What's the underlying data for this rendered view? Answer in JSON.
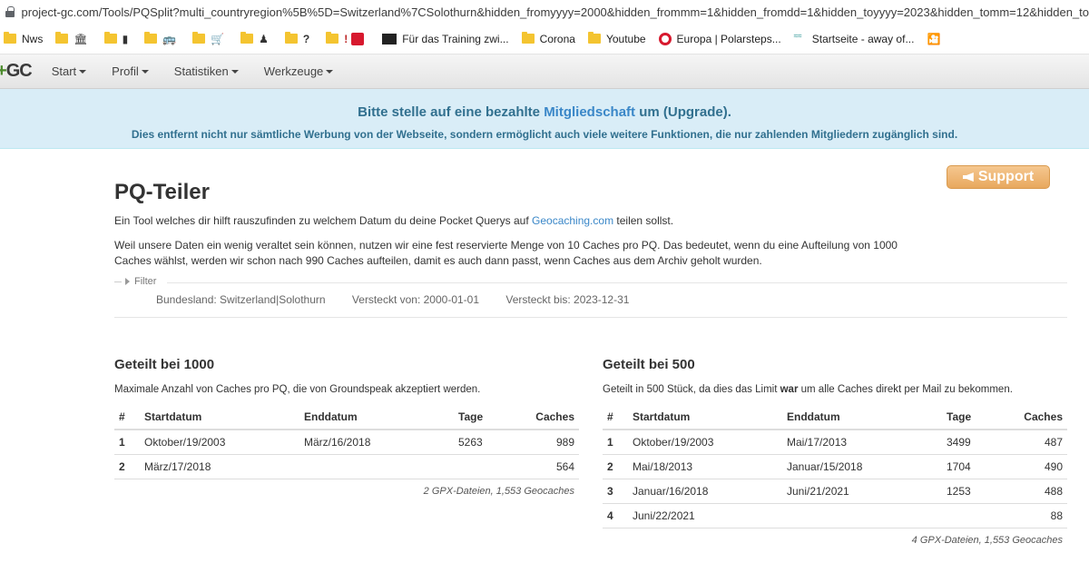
{
  "browser": {
    "url": "project-gc.com/Tools/PQSplit?multi_countryregion%5B%5D=Switzerland%7CSolothurn&hidden_fromyyyy=2000&hidden_frommm=1&hidden_fromdd=1&hidden_toyyyy=2023&hidden_tomm=12&hidden_to"
  },
  "bookmarks": [
    {
      "label": "Nws",
      "icon": "folder-icon"
    },
    {
      "label": "",
      "icon": "bank-icon"
    },
    {
      "label": "",
      "icon": "phone-icon"
    },
    {
      "label": "",
      "icon": "bus-icon"
    },
    {
      "label": "",
      "icon": "cart-icon"
    },
    {
      "label": "",
      "icon": "person-icon"
    },
    {
      "label": "",
      "icon": "question-icon"
    },
    {
      "label": "",
      "icon": "exclamation-icon"
    },
    {
      "label": "Für das Training zwi...",
      "icon": "training-icon"
    },
    {
      "label": "Corona",
      "icon": "folder-icon"
    },
    {
      "label": "Youtube",
      "icon": "folder-icon"
    },
    {
      "label": "Europa | Polarsteps...",
      "icon": "polarsteps-icon"
    },
    {
      "label": "Startseite - away of...",
      "icon": "away-icon"
    },
    {
      "label": "",
      "icon": "cinema-icon"
    }
  ],
  "nav": {
    "logo_text": "GC",
    "items": [
      "Start",
      "Profil",
      "Statistiken",
      "Werkzeuge"
    ]
  },
  "banner": {
    "line1_pre": "Bitte stelle auf eine bezahlte ",
    "line1_link": "Mitgliedschaft",
    "line1_post": " um (Upgrade).",
    "line2": "Dies entfernt nicht nur sämtliche Werbung von der Webseite, sondern ermöglicht auch viele weitere Funktionen, die nur zahlenden Mitgliedern zugänglich sind."
  },
  "support_label": "Support",
  "page": {
    "title": "PQ-Teiler",
    "intro1_pre": "Ein Tool welches dir hilft rauszufinden zu welchem Datum du deine Pocket Querys auf ",
    "intro1_link": "Geocaching.com",
    "intro1_post": " teilen sollst.",
    "intro2": "Weil unsere Daten ein wenig veraltet sein können, nutzen wir eine fest reservierte Menge von 10 Caches pro PQ. Das bedeutet, wenn du eine Aufteilung von 1000 Caches wählst, werden wir schon nach 990 Caches aufteilen, damit es auch dann passt, wenn Caches aus dem Archiv geholt wurden."
  },
  "filter": {
    "legend": "Filter",
    "region": "Bundesland: Switzerland|Solothurn",
    "from": "Versteckt von: 2000-01-01",
    "to": "Versteckt bis: 2023-12-31"
  },
  "columns": [
    "#",
    "Startdatum",
    "Enddatum",
    "Tage",
    "Caches"
  ],
  "split1000": {
    "title": "Geteilt bei 1000",
    "desc": "Maximale Anzahl von Caches pro PQ, die von Groundspeak akzeptiert werden.",
    "rows": [
      [
        "1",
        "Oktober/19/2003",
        "März/16/2018",
        "5263",
        "989"
      ],
      [
        "2",
        "März/17/2018",
        "",
        "",
        "564"
      ]
    ],
    "summary": "2 GPX-Dateien, 1,553 Geocaches"
  },
  "split500": {
    "title": "Geteilt bei 500",
    "desc_pre": "Geteilt in 500 Stück, da dies das Limit ",
    "desc_bold": "war",
    "desc_post": " um alle Caches direkt per Mail zu bekommen.",
    "rows": [
      [
        "1",
        "Oktober/19/2003",
        "Mai/17/2013",
        "3499",
        "487"
      ],
      [
        "2",
        "Mai/18/2013",
        "Januar/15/2018",
        "1704",
        "490"
      ],
      [
        "3",
        "Januar/16/2018",
        "Juni/21/2021",
        "1253",
        "488"
      ],
      [
        "4",
        "Juni/22/2021",
        "",
        "",
        "88"
      ]
    ],
    "summary": "4 GPX-Dateien, 1,553 Geocaches"
  }
}
